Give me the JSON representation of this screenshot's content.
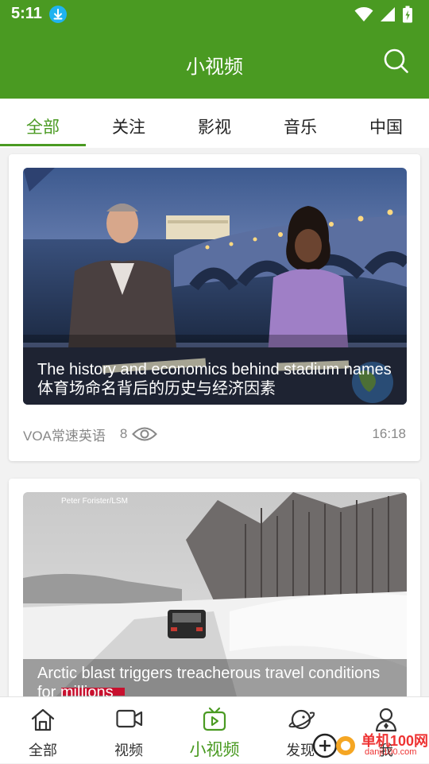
{
  "status_bar": {
    "time": "5:11",
    "icons": [
      "download-icon",
      "wifi-icon",
      "signal-icon",
      "battery-icon"
    ]
  },
  "header": {
    "title": "小视频",
    "search_icon": "search-icon"
  },
  "tabs": [
    {
      "label": "全部",
      "active": true
    },
    {
      "label": "关注"
    },
    {
      "label": "影视"
    },
    {
      "label": "音乐"
    },
    {
      "label": "中国"
    }
  ],
  "cards": [
    {
      "title_en": "The history and economics behind stadium names",
      "title_zh": "体育场命名背后的历史与经济因素",
      "source": "VOA常速英语",
      "views": "8",
      "duration": "16:18"
    },
    {
      "title_en": "Arctic blast triggers treacherous travel conditions for millions",
      "credit": "Peter Forister/LSM"
    }
  ],
  "bottom_nav": [
    {
      "label": "全部",
      "icon": "home-icon"
    },
    {
      "label": "视频",
      "icon": "video-camera-icon"
    },
    {
      "label": "小视频",
      "icon": "tv-icon",
      "active": true
    },
    {
      "label": "发现",
      "icon": "planet-icon"
    },
    {
      "label": "我",
      "icon": "user-icon"
    }
  ],
  "watermark": {
    "text": "单机100网",
    "subtext": "danji100.com"
  },
  "colors": {
    "brand": "#4a9a22",
    "meta_text": "#888888",
    "download_badge": "#1fb3f0"
  }
}
